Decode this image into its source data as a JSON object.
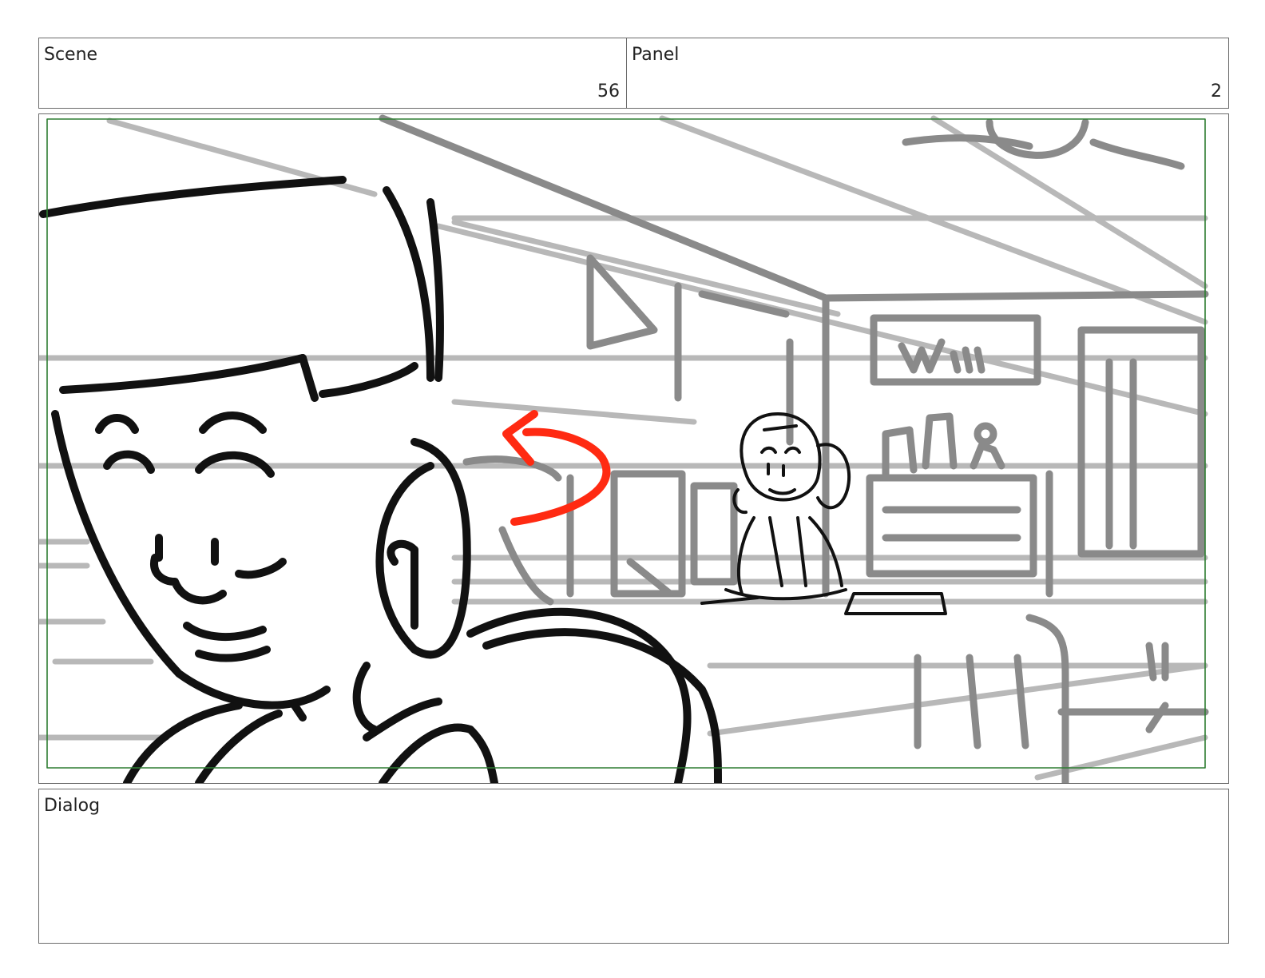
{
  "header": {
    "scene_label": "Scene",
    "scene_number": "56",
    "panel_label": "Panel",
    "panel_number": "2"
  },
  "dialog": {
    "label": "Dialog",
    "text": ""
  },
  "colors": {
    "frame_border": "#2e7d32",
    "sketch_gray": "#8a8a8a",
    "sketch_light": "#b5b5b5",
    "ink": "#111111",
    "action_arrow": "#ff2a12"
  }
}
